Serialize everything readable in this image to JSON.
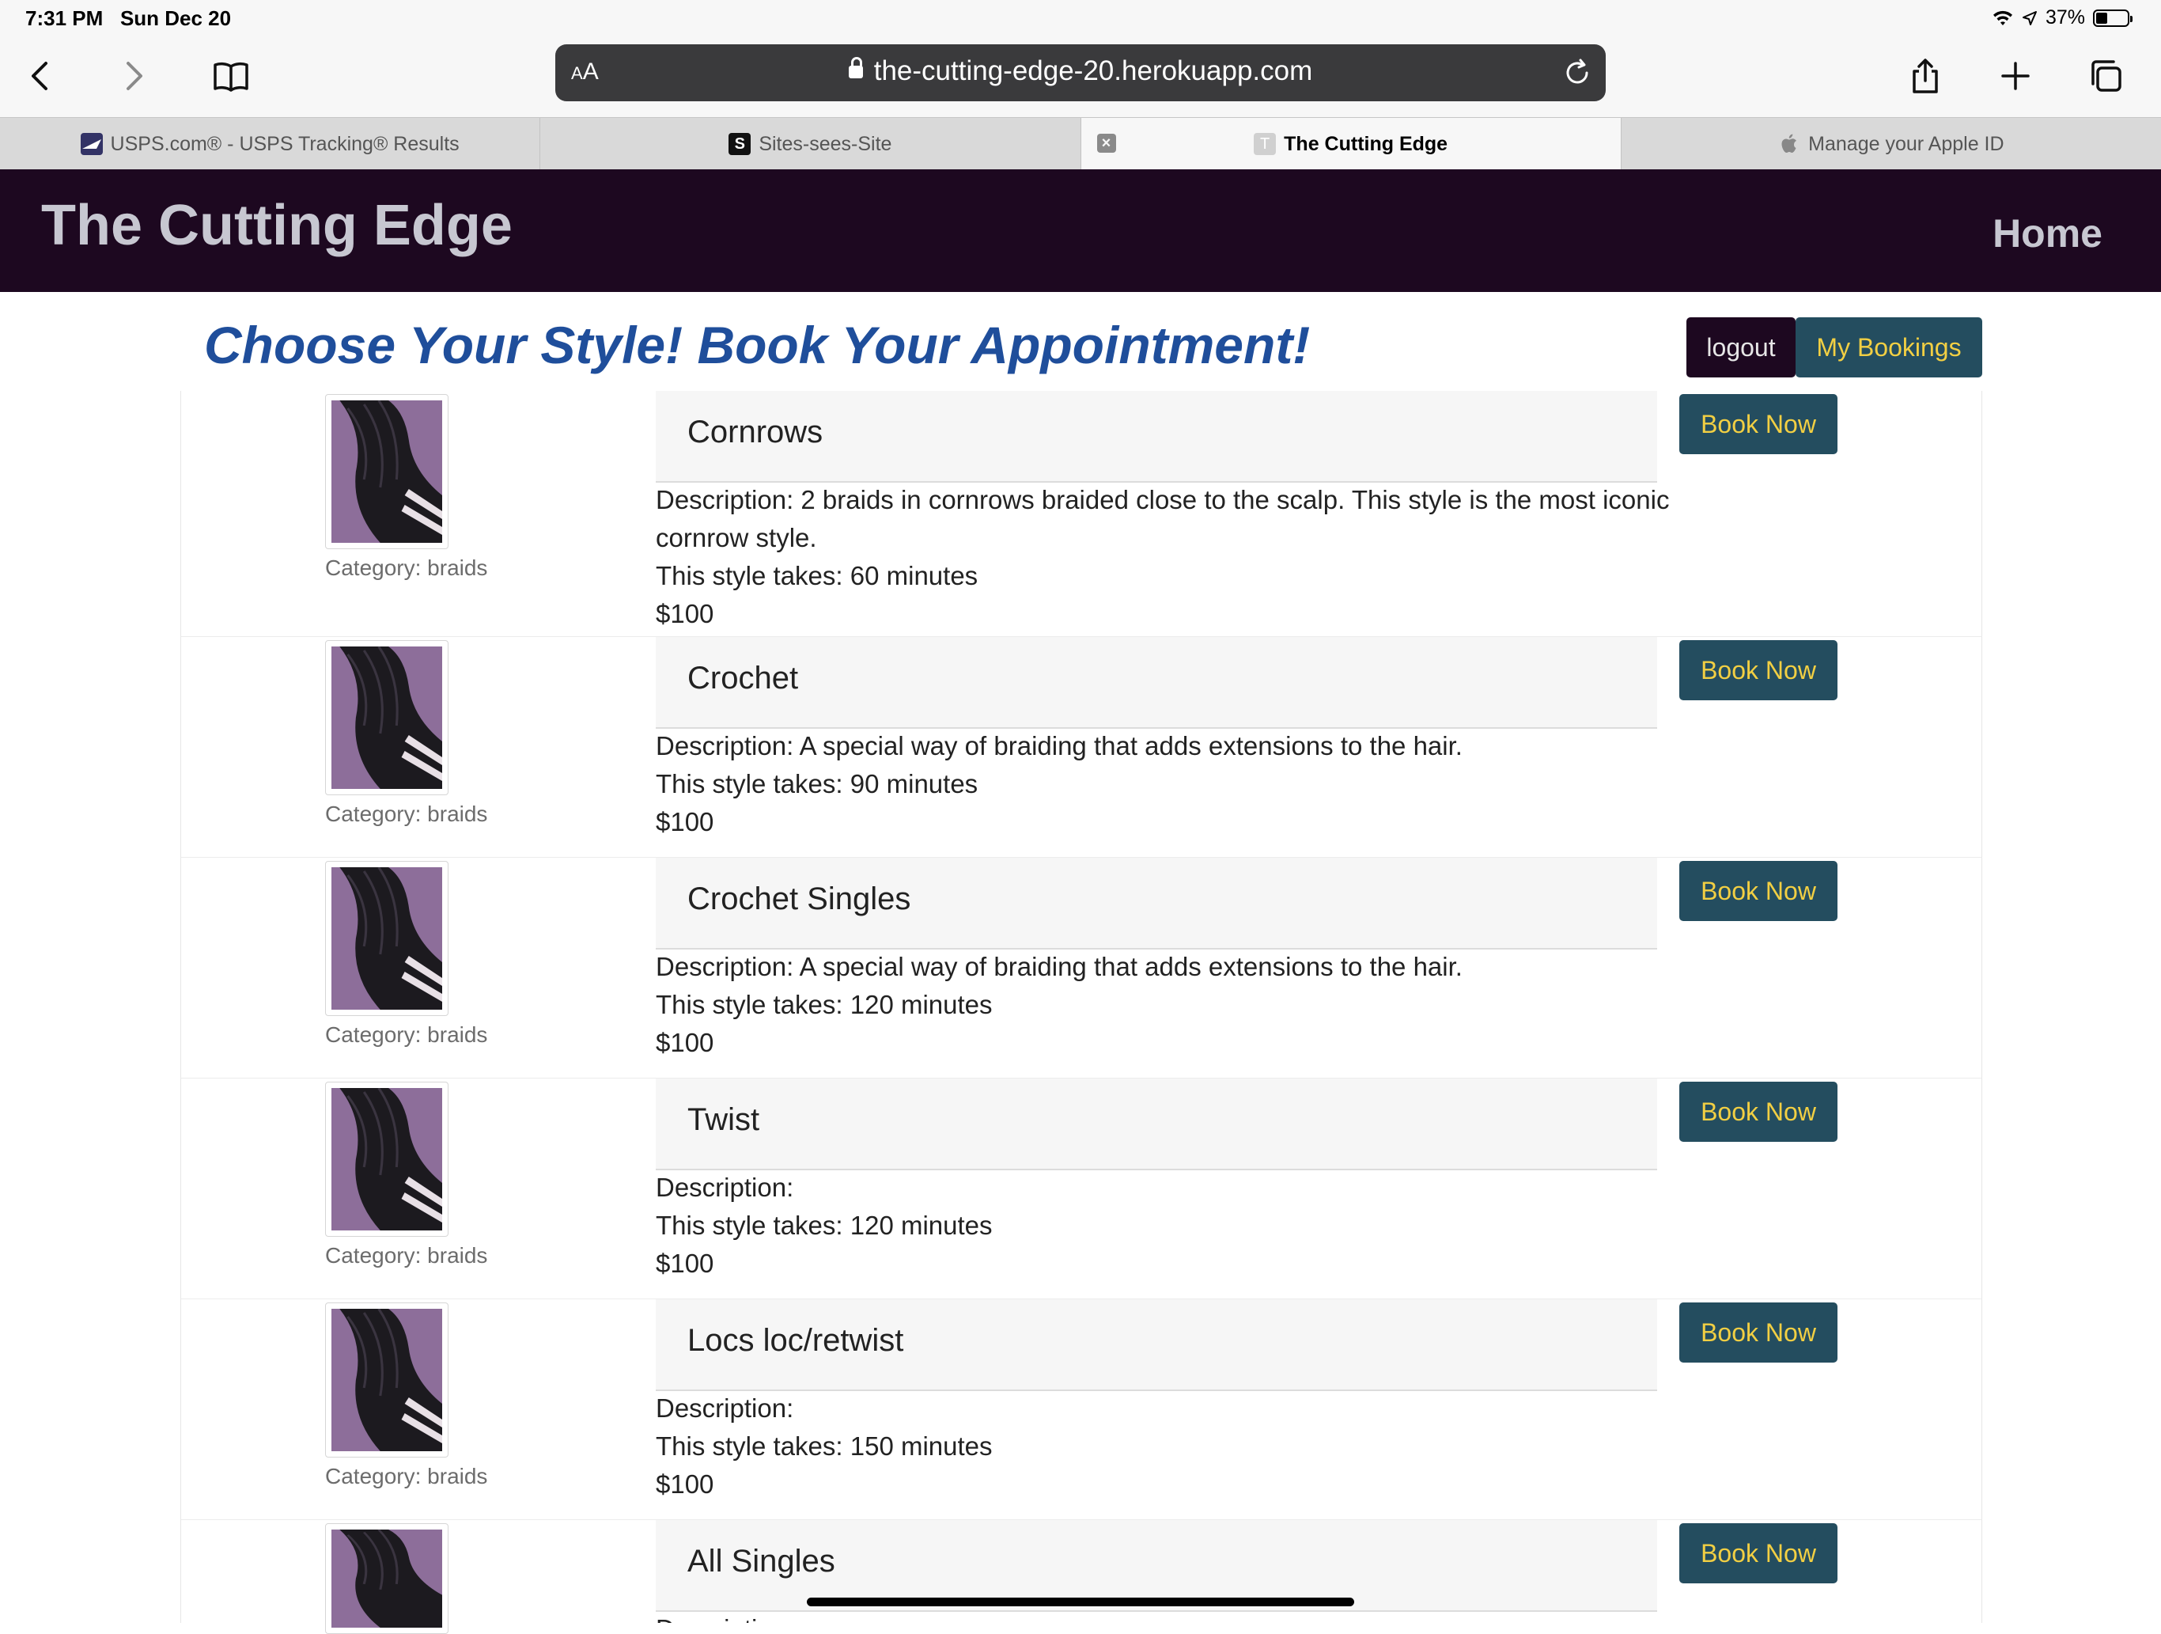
{
  "status": {
    "time": "7:31 PM",
    "date": "Sun Dec 20",
    "battery": "37%",
    "battery_level": 0.37
  },
  "browser": {
    "aa_label_small": "A",
    "aa_label": "A",
    "url": "the-cutting-edge-20.herokuapp.com",
    "tabs": [
      {
        "title": "USPS.com® - USPS Tracking® Results",
        "favicon": "usps-icon"
      },
      {
        "title": "Sites-sees-Site",
        "favicon": "S"
      },
      {
        "title": "The Cutting Edge",
        "favicon": "T",
        "close": "×"
      },
      {
        "title": "Manage your Apple ID",
        "favicon": "apple-icon"
      }
    ]
  },
  "site": {
    "brand": "The Cutting Edge",
    "nav_home": "Home"
  },
  "page": {
    "heading": "Choose Your Style! Book Your Appointment!",
    "logout": "logout",
    "my_bookings": "My Bookings"
  },
  "styles": [
    {
      "name": "Cornrows",
      "category": "Category: braids",
      "description": "Description: 2 braids in cornrows braided close to the scalp. This style is the most iconic cornrow style.",
      "duration": "This style takes: 60 minutes",
      "price": "$100",
      "book": "Book Now"
    },
    {
      "name": "Crochet",
      "category": "Category: braids",
      "description": "Description: A special way of braiding that adds extensions to the hair.",
      "duration": "This style takes: 90 minutes",
      "price": "$100",
      "book": "Book Now"
    },
    {
      "name": "Crochet Singles",
      "category": "Category: braids",
      "description": "Description: A special way of braiding that adds extensions to the hair.",
      "duration": "This style takes: 120 minutes",
      "price": "$100",
      "book": "Book Now"
    },
    {
      "name": "Twist",
      "category": "Category: braids",
      "description": "Description:",
      "duration": "This style takes: 120 minutes",
      "price": "$100",
      "book": "Book Now"
    },
    {
      "name": "Locs loc/retwist",
      "category": "Category: braids",
      "description": "Description:",
      "duration": "This style takes: 150 minutes",
      "price": "$100",
      "book": "Book Now"
    },
    {
      "name": "All Singles",
      "category": "",
      "description": "Description:",
      "duration": "",
      "price": "",
      "book": "Book Now"
    }
  ],
  "colors": {
    "header_bg": "#1d0820",
    "heading": "#1f4e9b",
    "button_bg": "#244d5f",
    "button_text": "#f2cf43"
  }
}
